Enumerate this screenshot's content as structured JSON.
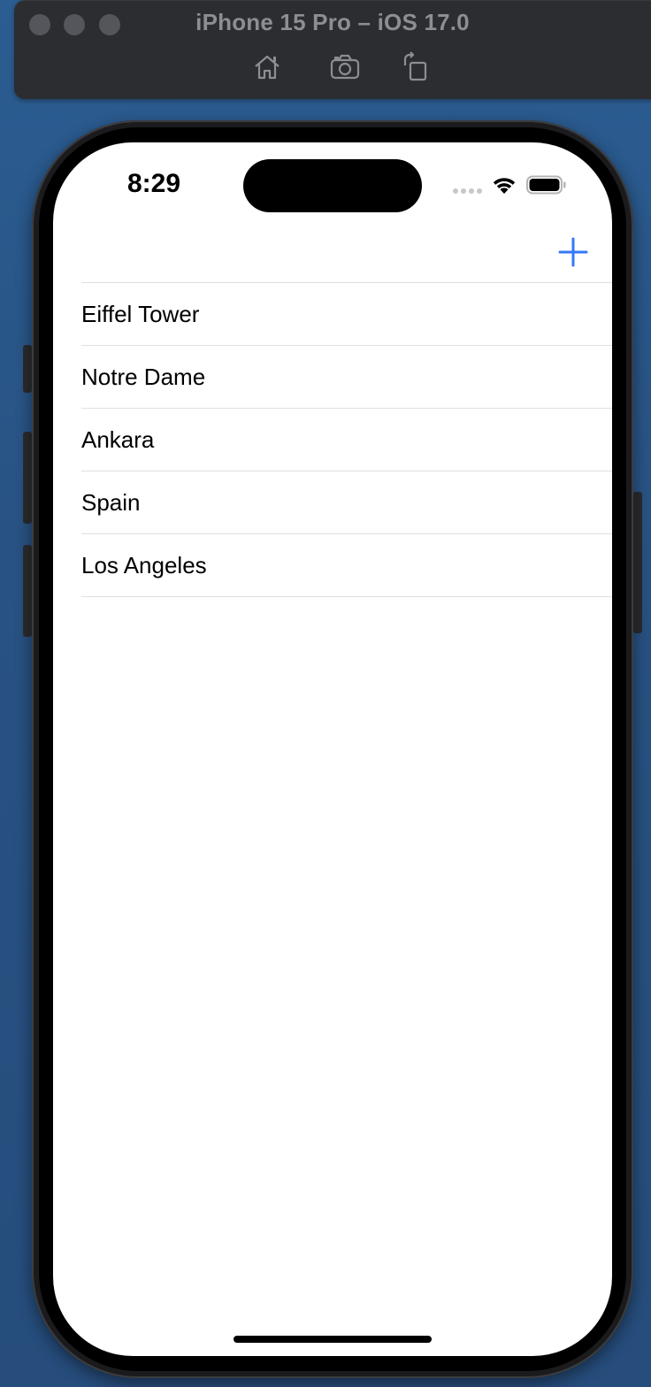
{
  "simulator": {
    "title": "iPhone 15 Pro – iOS 17.0",
    "toolbar": {
      "home_icon": "home-icon",
      "screenshot_icon": "camera-icon",
      "rotate_icon": "rotate-icon"
    }
  },
  "status_bar": {
    "time": "8:29",
    "signal_icon": "cellular-dots-icon",
    "wifi_icon": "wifi-icon",
    "battery_icon": "battery-icon"
  },
  "nav_bar": {
    "add_icon": "plus-icon",
    "accent_color": "#3478f6"
  },
  "places": [
    {
      "label": "Eiffel Tower"
    },
    {
      "label": "Notre Dame"
    },
    {
      "label": "Ankara"
    },
    {
      "label": "Spain"
    },
    {
      "label": "Los Angeles"
    }
  ]
}
